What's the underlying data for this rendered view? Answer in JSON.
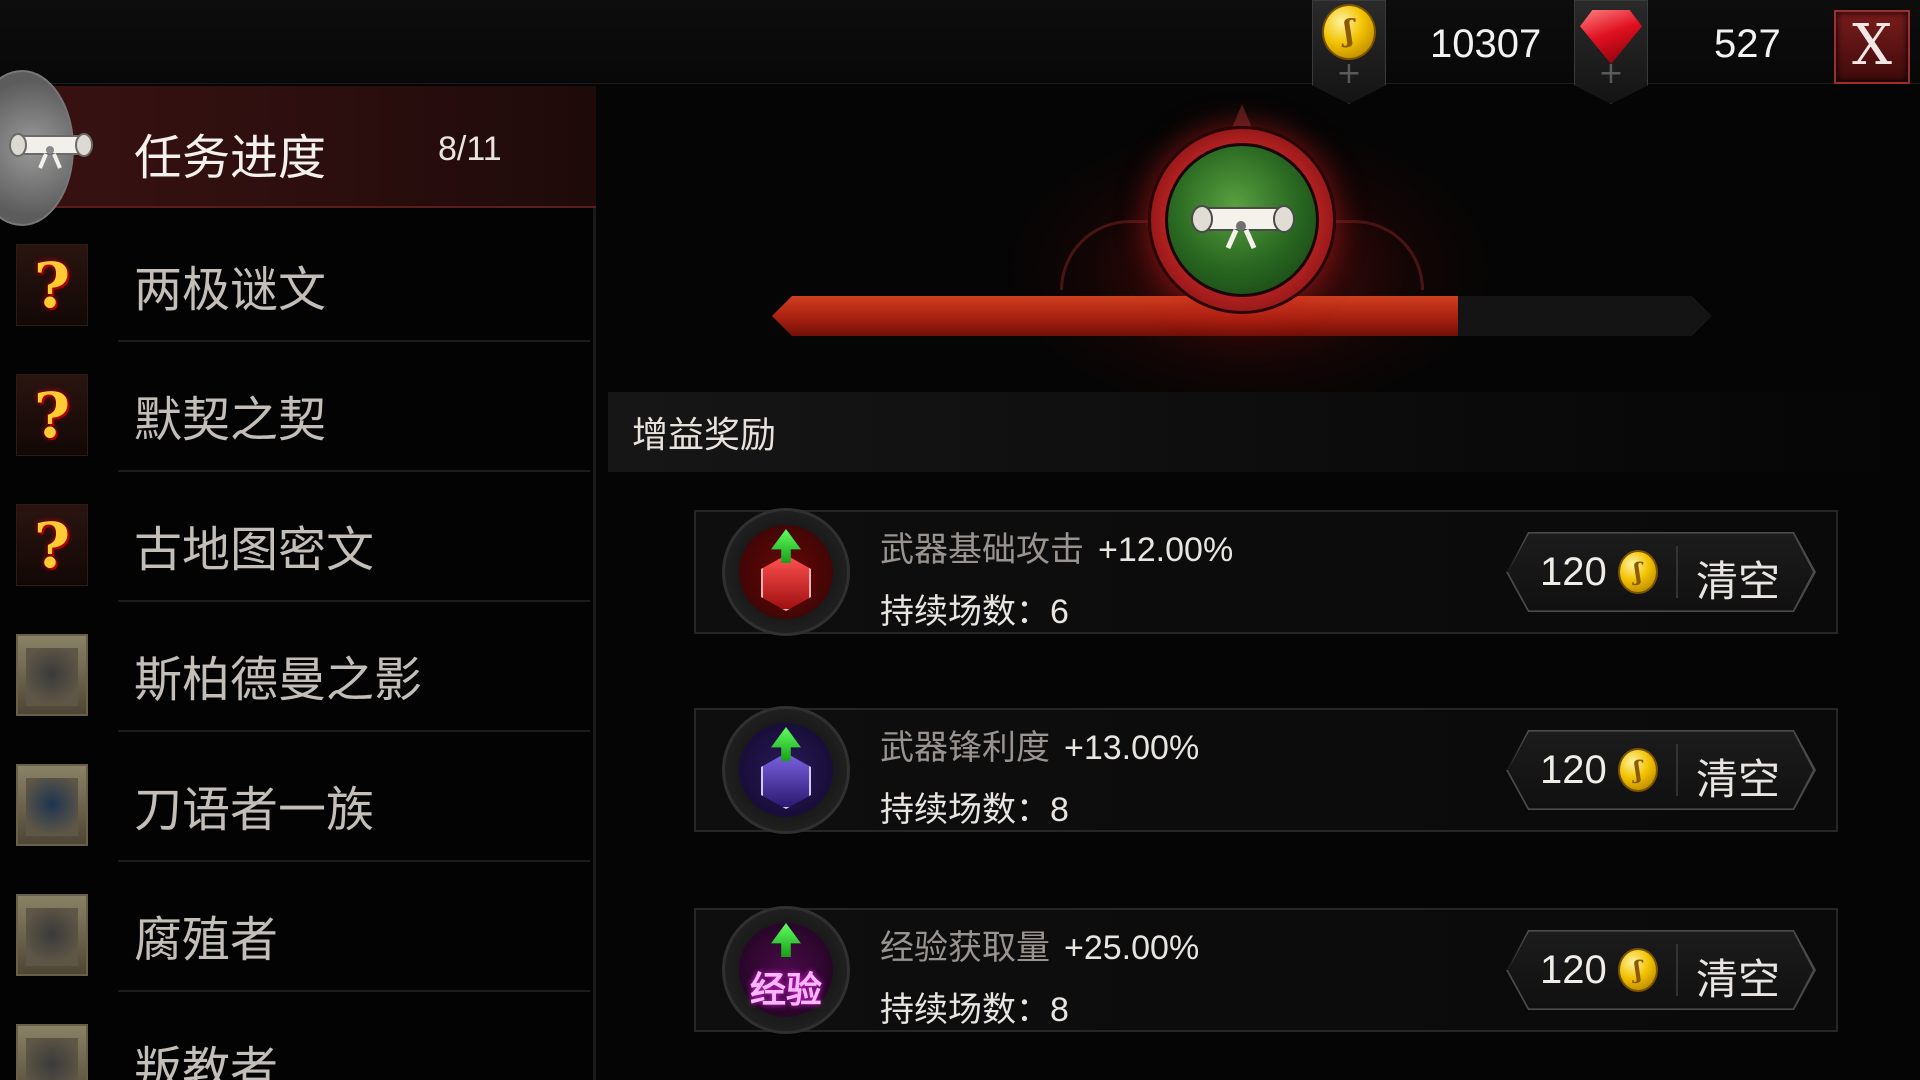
{
  "currencies": {
    "gold": {
      "icon": "gold-coin-icon",
      "value": "10307"
    },
    "gems": {
      "icon": "red-gem-icon",
      "value": "527"
    },
    "add_symbol": "+"
  },
  "close_label": "X",
  "quest_panel": {
    "title": "任务进度",
    "count": "8/11",
    "items": [
      {
        "label": "两极谜文",
        "icon": "quest-mark-icon",
        "mark": "?"
      },
      {
        "label": "默契之契",
        "icon": "quest-mark-icon",
        "mark": "?"
      },
      {
        "label": "古地图密文",
        "icon": "quest-mark-icon",
        "mark": "?"
      },
      {
        "label": "斯柏德曼之影",
        "icon": "monster-card-icon"
      },
      {
        "label": "刀语者一族",
        "icon": "monster-card-icon"
      },
      {
        "label": "腐殖者",
        "icon": "monster-card-icon"
      },
      {
        "label": "叛教者",
        "icon": "monster-card-icon"
      }
    ]
  },
  "progress": {
    "fraction": 0.73,
    "color": "#c0341a"
  },
  "rewards": {
    "section_title": "增益奖励",
    "duration_label": "持续场数：",
    "buffs": [
      {
        "name": "武器基础攻击",
        "value": "+12.00%",
        "duration": "6",
        "cost": "120",
        "action": "清空",
        "icon": "weapon-attack-icon",
        "color": "#c01818"
      },
      {
        "name": "武器锋利度",
        "value": "+13.00%",
        "duration": "8",
        "cost": "120",
        "action": "清空",
        "icon": "weapon-sharpness-icon",
        "color": "#5a3aa8"
      },
      {
        "name": "经验获取量",
        "value": "+25.00%",
        "duration": "8",
        "cost": "120",
        "action": "清空",
        "icon": "experience-icon",
        "icon_text": "经验",
        "color": "#a020b0"
      }
    ]
  }
}
